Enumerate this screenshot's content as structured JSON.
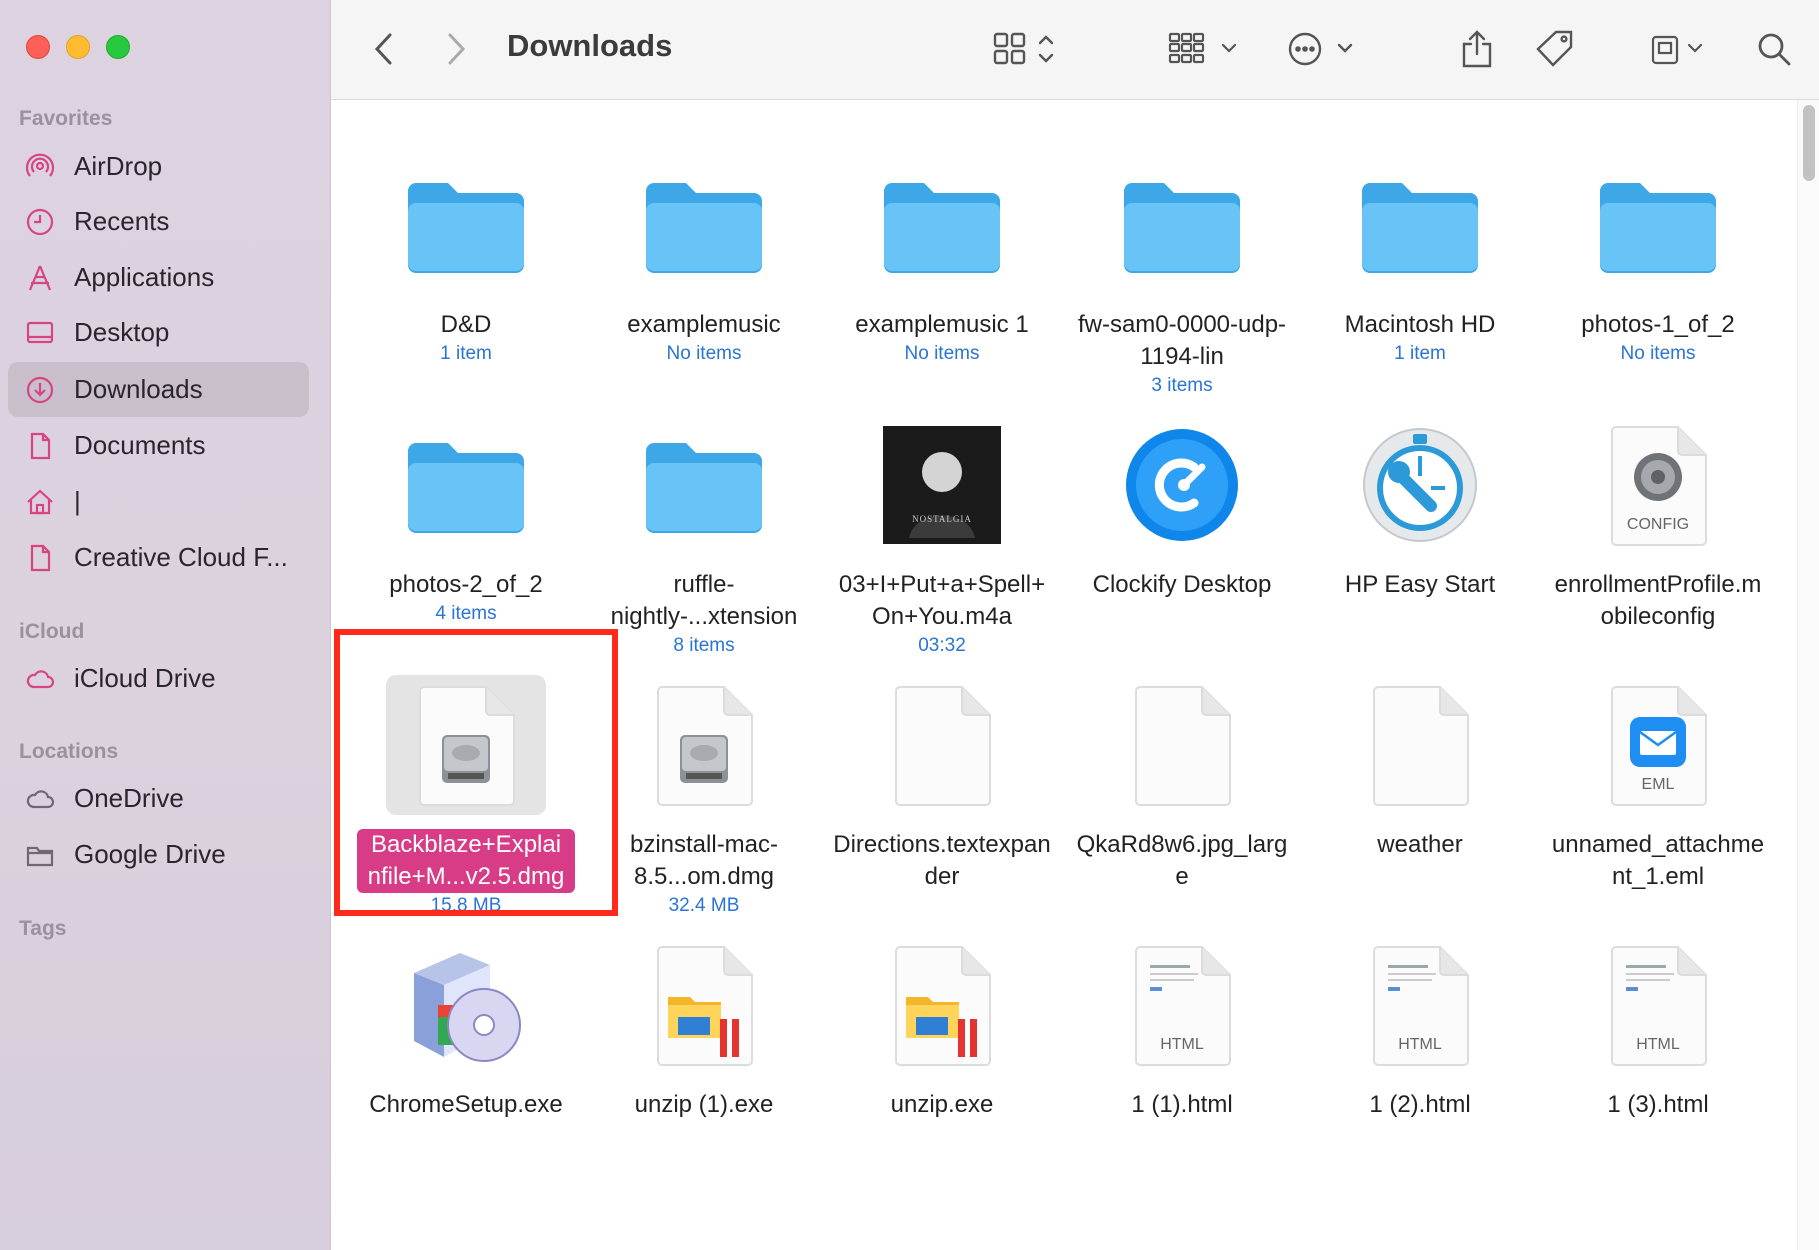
{
  "window": {
    "title": "Downloads"
  },
  "sidebar": {
    "sections": [
      {
        "label": "Favorites",
        "items": [
          {
            "label": "AirDrop",
            "icon": "airdrop-icon"
          },
          {
            "label": "Recents",
            "icon": "clock-icon"
          },
          {
            "label": "Applications",
            "icon": "applications-icon"
          },
          {
            "label": "Desktop",
            "icon": "desktop-icon"
          },
          {
            "label": "Downloads",
            "icon": "download-icon",
            "active": true
          },
          {
            "label": "Documents",
            "icon": "document-icon"
          },
          {
            "label": "|",
            "icon": "home-icon"
          },
          {
            "label": "Creative Cloud F...",
            "icon": "file-icon"
          }
        ]
      },
      {
        "label": "iCloud",
        "items": [
          {
            "label": "iCloud Drive",
            "icon": "cloud-icon"
          }
        ]
      },
      {
        "label": "Locations",
        "items": [
          {
            "label": "OneDrive",
            "icon": "cloud-icon"
          },
          {
            "label": "Google Drive",
            "icon": "folder-icon"
          }
        ]
      },
      {
        "label": "Tags",
        "items": []
      }
    ]
  },
  "toolbar": {
    "back": "back-icon",
    "forward": "forward-icon",
    "view": "grid-view-icon",
    "group": "group-icon",
    "action": "more-icon",
    "share": "share-icon",
    "tag": "tag-icon",
    "drive": "drive-icon",
    "search": "search-icon"
  },
  "files": [
    {
      "name": "D&D",
      "sub": "1 item",
      "kind": "folder"
    },
    {
      "name": "examplemusic",
      "sub": "No items",
      "kind": "folder"
    },
    {
      "name": "examplemusic 1",
      "sub": "No items",
      "kind": "folder"
    },
    {
      "name": "fw-sam0-0000-udp-1194-lin",
      "sub": "3 items",
      "kind": "folder"
    },
    {
      "name": "Macintosh HD",
      "sub": "1 item",
      "kind": "folder"
    },
    {
      "name": "photos-1_of_2",
      "sub": "No items",
      "kind": "folder"
    },
    {
      "name": "photos-2_of_2",
      "sub": "4 items",
      "kind": "folder"
    },
    {
      "name": "ruffle-nightly-...xtension",
      "sub": "8 items",
      "kind": "folder"
    },
    {
      "name": "03+I+Put+a+Spell+On+You.m4a",
      "sub": "03:32",
      "kind": "album",
      "art_text": "NOSTALGIA"
    },
    {
      "name": "Clockify Desktop",
      "sub": "",
      "kind": "clockify"
    },
    {
      "name": "HP Easy Start",
      "sub": "",
      "kind": "hp"
    },
    {
      "name": "enrollmentProfile.mobileconfig",
      "sub": "",
      "kind": "config",
      "badge": "CONFIG"
    },
    {
      "name": "Backblaze+Explainfile+M...v2.5.dmg",
      "sub": "15.8 MB",
      "kind": "dmg",
      "selected": true
    },
    {
      "name": "bzinstall-mac-8.5...om.dmg",
      "sub": "32.4 MB",
      "kind": "dmg"
    },
    {
      "name": "Directions.textexpander",
      "sub": "",
      "kind": "blank"
    },
    {
      "name": "QkaRd8w6.jpg_large",
      "sub": "",
      "kind": "blank"
    },
    {
      "name": "weather",
      "sub": "",
      "kind": "blank"
    },
    {
      "name": "unnamed_attachment_1.eml",
      "sub": "",
      "kind": "eml",
      "badge": "EML"
    },
    {
      "name": "ChromeSetup.exe",
      "sub": "",
      "kind": "setup"
    },
    {
      "name": "unzip (1).exe",
      "sub": "",
      "kind": "exe"
    },
    {
      "name": "unzip.exe",
      "sub": "",
      "kind": "exe"
    },
    {
      "name": "1 (1).html",
      "sub": "",
      "kind": "html",
      "badge": "HTML"
    },
    {
      "name": "1 (2).html",
      "sub": "",
      "kind": "html",
      "badge": "HTML"
    },
    {
      "name": "1 (3).html",
      "sub": "",
      "kind": "html",
      "badge": "HTML"
    }
  ]
}
